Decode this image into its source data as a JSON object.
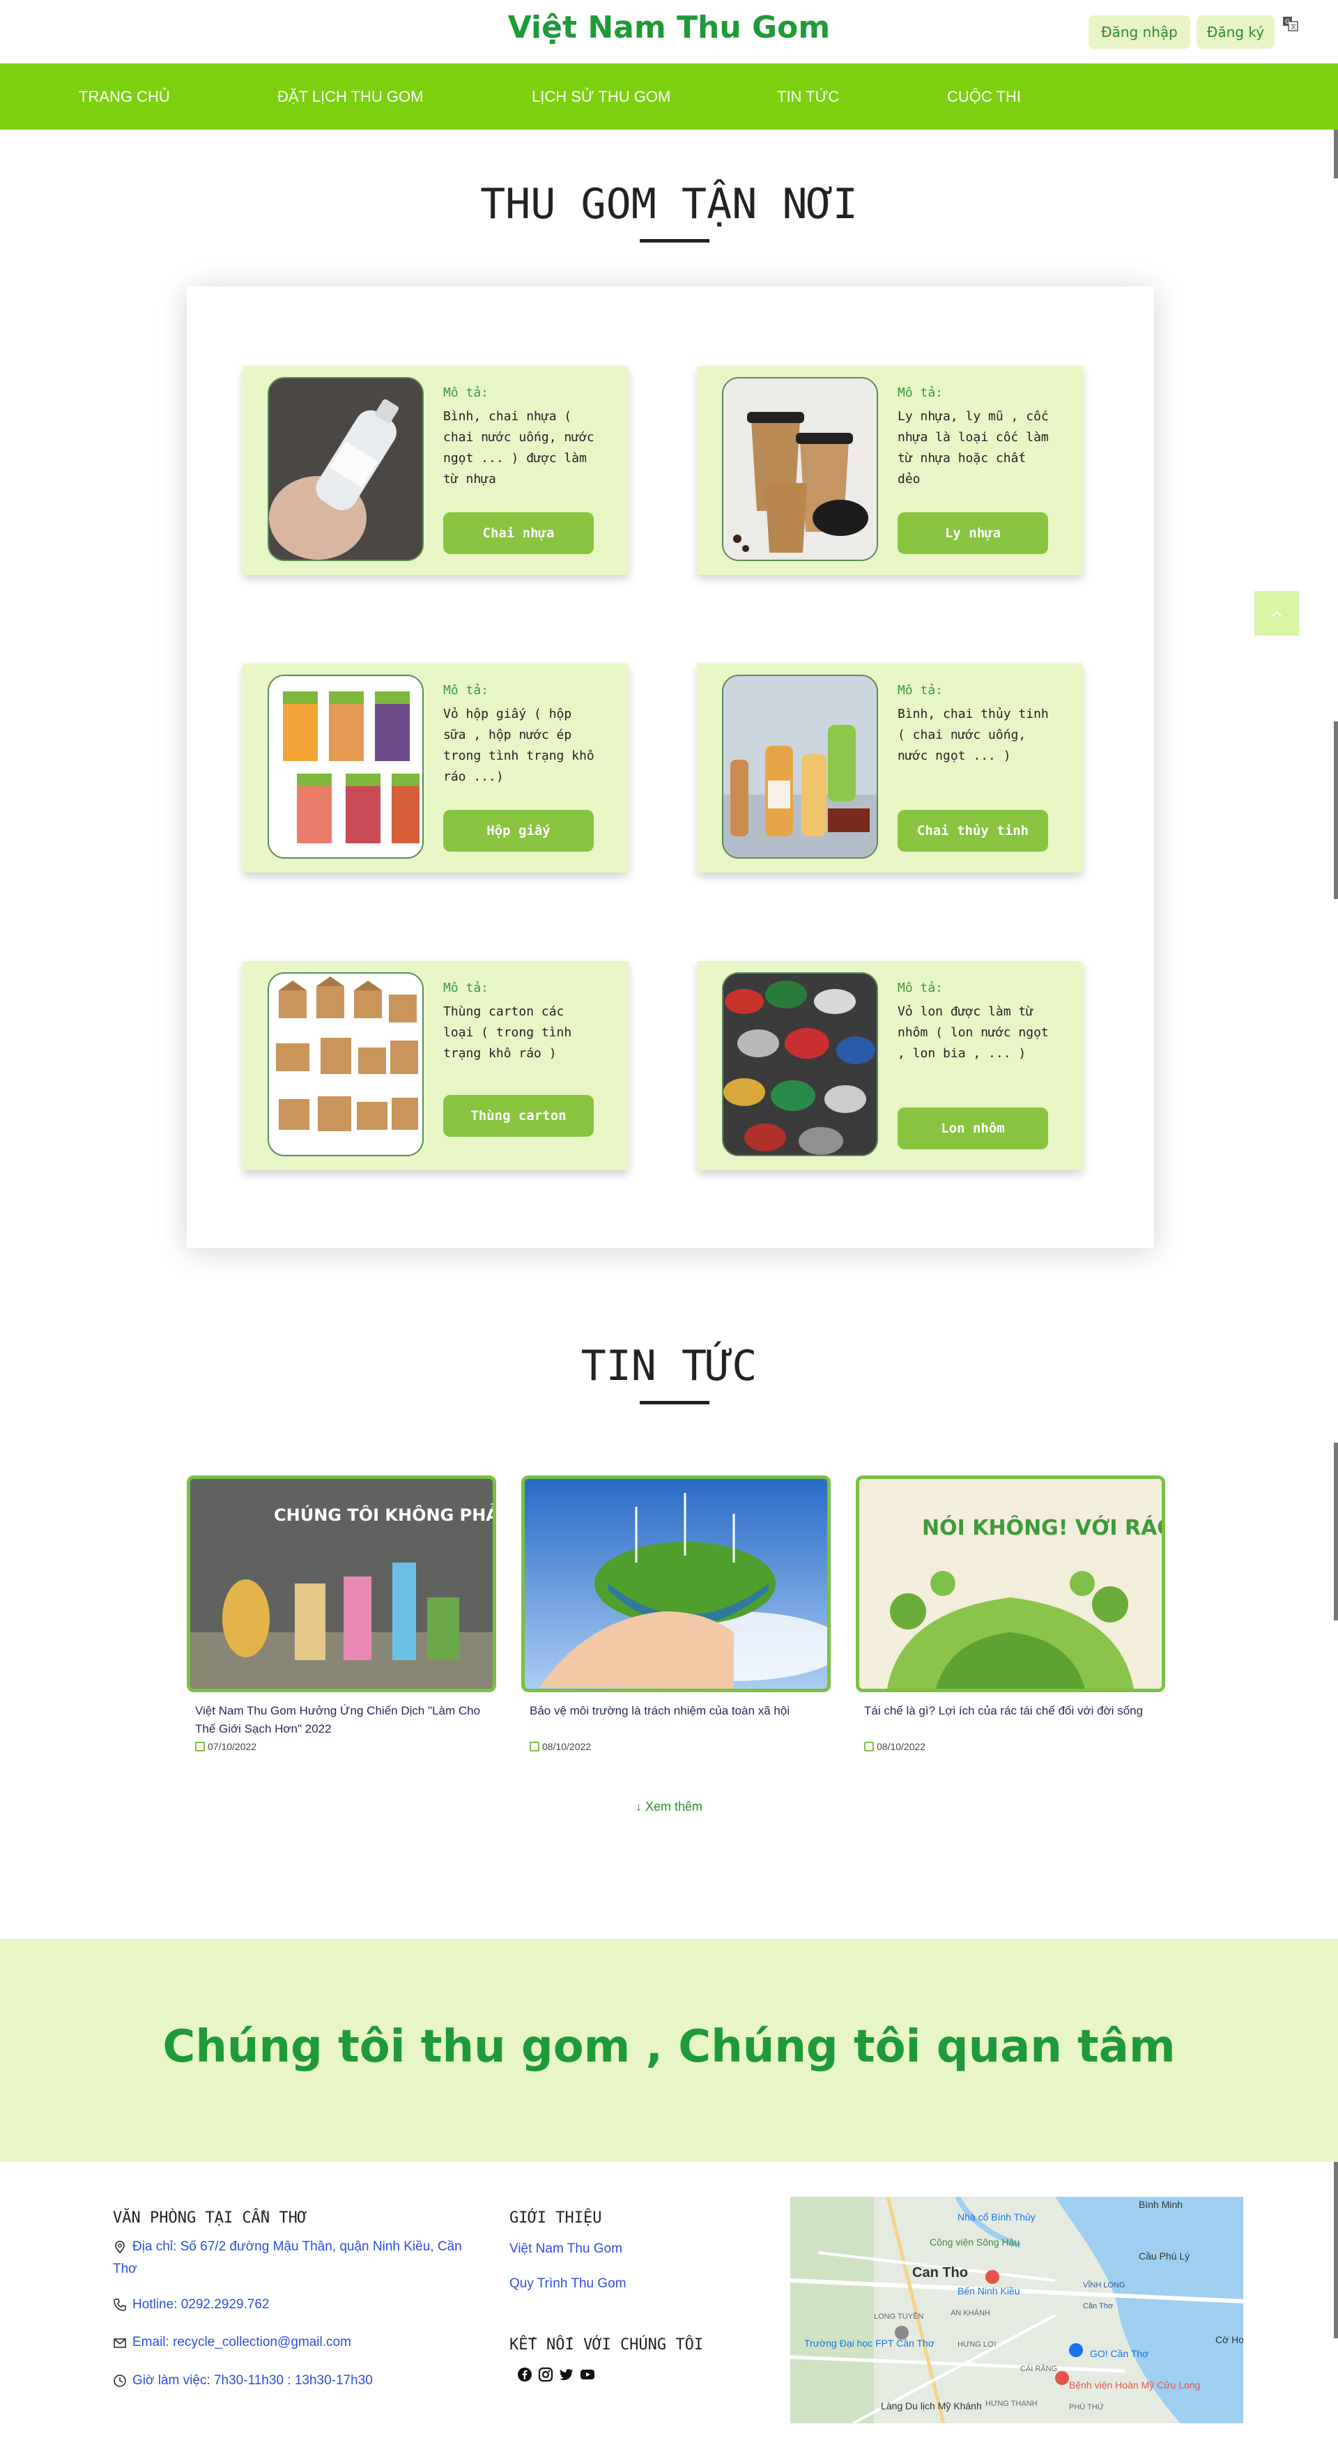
{
  "header": {
    "brand": "Việt Nam Thu Gom",
    "login_label": "Đăng nhập",
    "register_label": "Đăng ký",
    "translate_icon": "translate-icon"
  },
  "nav": {
    "items": [
      {
        "label": "TRANG CHỦ"
      },
      {
        "label": "ĐẶT LỊCH THU GOM"
      },
      {
        "label": "LỊCH SỬ THU GOM"
      },
      {
        "label": "TIN TỨC"
      },
      {
        "label": "CUỘC THI"
      }
    ]
  },
  "collection": {
    "title": "THU GOM TẬN NƠI",
    "desc_label": "Mô tả:",
    "items": [
      {
        "desc": "Bình, chai nhựa ( chai nước uống, nước ngọt ... ) được làm từ nhựa",
        "button": "Chai nhựa",
        "image": "plastic-bottle"
      },
      {
        "desc": "Ly nhựa, ly mũ , cốc nhựa là loại cốc làm từ nhựa hoặc chất dẻo",
        "button": "Ly nhựa",
        "image": "plastic-cups"
      },
      {
        "desc": "Vỏ hộp giấy ( hộp sữa , hộp nước ép trong tình trạng khô ráo ...)",
        "button": "Hộp giấy",
        "image": "paper-cartons"
      },
      {
        "desc": "Bình, chai thủy tinh ( chai nước uống, nước ngọt ... )",
        "button": "Chai thủy tinh",
        "image": "glass-bottles"
      },
      {
        "desc": "Thùng carton các loại ( trong tình trạng khô ráo )",
        "button": "Thùng carton",
        "image": "cardboard-boxes"
      },
      {
        "desc": "Vỏ lon được làm từ nhôm ( lon nước ngọt , lon bia , ... )",
        "button": "Lon nhôm",
        "image": "aluminum-cans"
      }
    ]
  },
  "news": {
    "title": "TIN TỨC",
    "items": [
      {
        "title": "Việt Nam Thu Gom Hưởng Ứng Chiến Dịch \"Làm Cho Thế Giới Sạch Hơn\" 2022",
        "date": "07/10/2022",
        "image_caption": "CHÚNG TÔI KHÔNG PHẢI LÀ RÁC"
      },
      {
        "title": "Bảo vệ môi trường là trách nhiệm của toàn xã hội",
        "date": "08/10/2022",
        "image_caption": ""
      },
      {
        "title": "Tái chế là gì? Lợi ích của rác tái chế đối với đời sống",
        "date": "08/10/2022",
        "image_caption": "NÓI KHÔNG! VỚI RÁC THẢI NHỰA"
      }
    ],
    "see_more": "↓ Xem thêm"
  },
  "banner": {
    "text": "Chúng tôi thu gom , Chúng tôi quan tâm"
  },
  "footer": {
    "office_heading": "VĂN PHÒNG TẠI CẦN THƠ",
    "address": "Địa chỉ: Số 67/2 đường Mậu Thân, quận Ninh Kiều, Cần Thơ",
    "hotline": "Hotline: 0292.2929.762",
    "email": "Email: recycle_collection@gmail.com",
    "hours": "Giờ làm việc: 7h30-11h30 : 13h30-17h30",
    "intro_heading": "GIỚI THIỆU",
    "intro_links": [
      "Việt Nam Thu Gom",
      "Quy Trình Thu Gom"
    ],
    "connect_heading": "KẾT NỐI VỚI CHÚNG TÔI",
    "social_icons": [
      "facebook-icon",
      "instagram-icon",
      "twitter-icon",
      "youtube-icon"
    ]
  },
  "map": {
    "labels": [
      "Bình Minh",
      "Nhà cổ Bình Thủy",
      "Công viên Sông Hậu",
      "Can Tho",
      "Bến Ninh Kiều",
      "Cầu Phú Lý",
      "Trường Đại học FPT Cần Thơ",
      "GO! Cần Thơ",
      "Bệnh viện Hoàn Mỹ Cửu Long",
      "Làng Du lịch Mỹ Khánh",
      "Cờ Ho",
      "CÁI RĂNG",
      "AN KHÁNH",
      "HƯNG LỢI",
      "LONG TUYỀN",
      "PHÚ THỨ",
      "HƯNG THẠNH",
      "VĨNH LONG",
      "Cần Thơ"
    ]
  }
}
